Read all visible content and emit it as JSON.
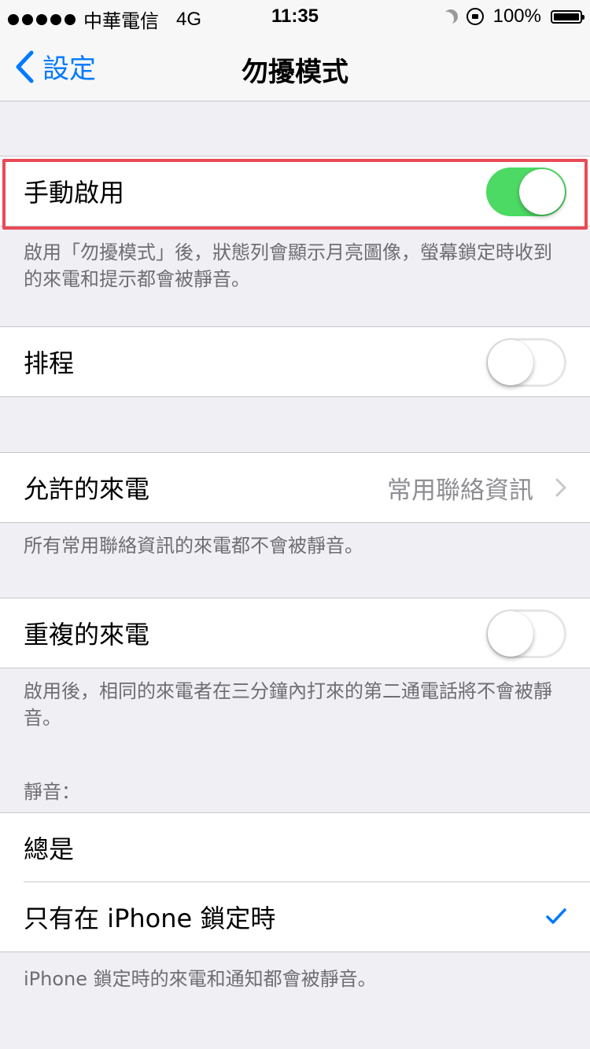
{
  "status_bar": {
    "carrier": "中華電信",
    "network": "4G",
    "time": "11:35",
    "battery_level": "100%",
    "icons": [
      "signal-dots-icon",
      "moon-icon",
      "rotation-lock-icon",
      "battery-icon"
    ]
  },
  "nav": {
    "back_label": "設定",
    "title": "勿擾模式"
  },
  "manual": {
    "label": "手動啟用",
    "toggle_on": true,
    "footer": "啟用「勿擾模式」後，狀態列會顯示月亮圖像，螢幕鎖定時收到的來電和提示都會被靜音。"
  },
  "schedule": {
    "label": "排程",
    "toggle_on": false
  },
  "allow_calls": {
    "label": "允許的來電",
    "value": "常用聯絡資訊",
    "footer": "所有常用聯絡資訊的來電都不會被靜音。"
  },
  "repeated_calls": {
    "label": "重複的來電",
    "toggle_on": false,
    "footer": "啟用後，相同的來電者在三分鐘內打來的第二通電話將不會被靜音。"
  },
  "silence": {
    "header": "靜音：",
    "options": [
      {
        "label": "總是",
        "selected": false
      },
      {
        "label": "只有在 iPhone 鎖定時",
        "selected": true
      }
    ],
    "footer": "iPhone 鎖定時的來電和通知都會被靜音。"
  },
  "colors": {
    "accent": "#007aff",
    "toggle_on": "#4cd964",
    "highlight": "#e94a56",
    "background": "#efeff4"
  }
}
